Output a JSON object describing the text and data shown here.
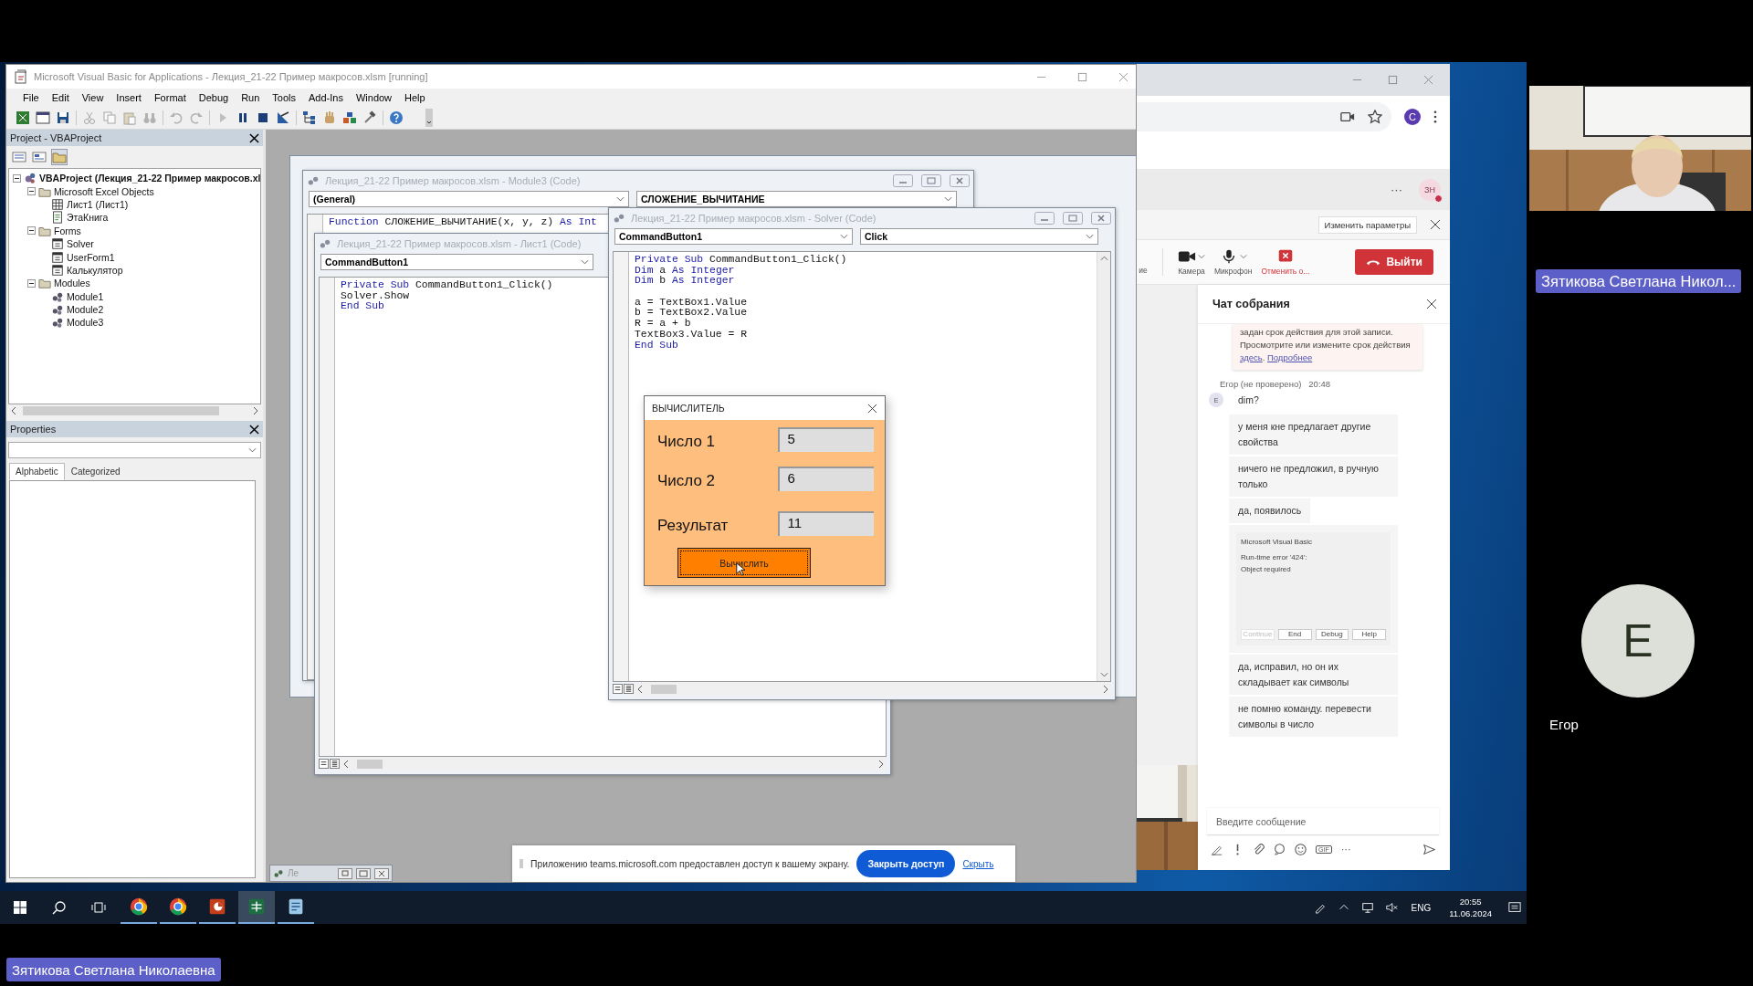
{
  "vba": {
    "title": "Microsoft Visual Basic for Applications - Лекция_21-22 Пример макросов.xlsm [running]",
    "menu": [
      "File",
      "Edit",
      "View",
      "Insert",
      "Format",
      "Debug",
      "Run",
      "Tools",
      "Add-Ins",
      "Window",
      "Help"
    ],
    "project": {
      "title": "Project - VBAProject",
      "tree": [
        {
          "label": "VBAProject (Лекция_21-22 Пример макросов.xl",
          "kind": "project",
          "expanded": true,
          "children": [
            {
              "label": "Microsoft Excel Objects",
              "kind": "folder",
              "expanded": true,
              "children": [
                {
                  "label": "Лист1 (Лист1)",
                  "kind": "sheet"
                },
                {
                  "label": "ЭтаКнига",
                  "kind": "workbook"
                }
              ]
            },
            {
              "label": "Forms",
              "kind": "folder",
              "expanded": true,
              "children": [
                {
                  "label": "Solver",
                  "kind": "form"
                },
                {
                  "label": "UserForm1",
                  "kind": "form"
                },
                {
                  "label": "Калькулятор",
                  "kind": "form"
                }
              ]
            },
            {
              "label": "Modules",
              "kind": "folder",
              "expanded": true,
              "children": [
                {
                  "label": "Module1",
                  "kind": "module"
                },
                {
                  "label": "Module2",
                  "kind": "module"
                },
                {
                  "label": "Module3",
                  "kind": "module"
                }
              ]
            }
          ]
        }
      ]
    },
    "properties": {
      "title": "Properties",
      "tabs": [
        {
          "label": "Alphabetic",
          "selected": true
        },
        {
          "label": "Categorized",
          "selected": false
        }
      ]
    },
    "code_windows": [
      {
        "title": "Лекция_21-22 Пример макросов.xlsm - Module3 (Code)",
        "dropdowns": [
          "(General)",
          "СЛОЖЕНИЕ_ВЫЧИТАНИЕ"
        ],
        "lines": [
          {
            "kind": "code",
            "segments": [
              {
                "kind": "keyword",
                "text": "Function"
              },
              {
                "kind": "plain",
                "text": " СЛОЖЕНИЕ_ВЫЧИТАНИЕ(x, y, z) "
              },
              {
                "kind": "keyword",
                "text": "As Int"
              }
            ]
          }
        ]
      },
      {
        "title": "Лекция_21-22 Пример макросов.xlsm - Лист1 (Code)",
        "dropdowns": [
          "CommandButton1"
        ],
        "lines": [
          {
            "kind": "code",
            "segments": [
              {
                "kind": "keyword",
                "text": "Private Sub"
              },
              {
                "kind": "plain",
                "text": " CommandButton1_Click()"
              }
            ]
          },
          {
            "kind": "code",
            "segments": [
              {
                "kind": "plain",
                "text": "Solver.Show"
              }
            ]
          },
          {
            "kind": "code",
            "segments": [
              {
                "kind": "keyword",
                "text": "End Sub"
              }
            ]
          }
        ]
      },
      {
        "title": "Лекция_21-22 Пример макросов.xlsm - Solver (Code)",
        "dropdowns": [
          "CommandButton1",
          "Click"
        ],
        "lines": [
          {
            "kind": "code",
            "segments": [
              {
                "kind": "keyword",
                "text": "Private Sub"
              },
              {
                "kind": "plain",
                "text": " CommandButton1_Click()"
              }
            ]
          },
          {
            "kind": "code",
            "segments": [
              {
                "kind": "keyword",
                "text": "Dim"
              },
              {
                "kind": "plain",
                "text": " a "
              },
              {
                "kind": "keyword",
                "text": "As Integer"
              }
            ]
          },
          {
            "kind": "code",
            "segments": [
              {
                "kind": "keyword",
                "text": "Dim"
              },
              {
                "kind": "plain",
                "text": " b "
              },
              {
                "kind": "keyword",
                "text": "As Integer"
              }
            ]
          },
          {
            "kind": "blank"
          },
          {
            "kind": "code",
            "segments": [
              {
                "kind": "plain",
                "text": "a = TextBox1.Value"
              }
            ]
          },
          {
            "kind": "code",
            "segments": [
              {
                "kind": "plain",
                "text": "b = TextBox2.Value"
              }
            ]
          },
          {
            "kind": "code",
            "segments": [
              {
                "kind": "plain",
                "text": "R = a + b"
              }
            ]
          },
          {
            "kind": "code",
            "segments": [
              {
                "kind": "plain",
                "text": "TextBox3.Value = R"
              }
            ]
          },
          {
            "kind": "code",
            "segments": [
              {
                "kind": "keyword",
                "text": "End Sub"
              }
            ]
          }
        ]
      }
    ],
    "minimized": {
      "title": "Ле"
    },
    "form": {
      "title": "ВЫЧИСЛИТЕЛЬ",
      "fields": [
        {
          "label": "Число 1",
          "value": "5"
        },
        {
          "label": "Число 2",
          "value": "6"
        },
        {
          "label": "Результат",
          "value": "11"
        }
      ],
      "button": "Вычислить"
    }
  },
  "browser": {
    "avatar": "C"
  },
  "teams": {
    "more": "···",
    "user_initials": "ЗН",
    "notice_button": "Изменить параметры",
    "controls": [
      {
        "label": "ие",
        "kind": "cut"
      },
      {
        "label": "Камера",
        "kind": "camera"
      },
      {
        "label": "Микрофон",
        "kind": "mic"
      },
      {
        "label": "Отменить о...",
        "kind": "stop-share"
      }
    ],
    "leave": "Выйти",
    "chat": {
      "title": "Чат собрания",
      "notice": [
        {
          "kind": "text",
          "text": "задан срок действия для этой записи. Просмотрите или измените срок действия "
        },
        {
          "kind": "link",
          "text": "здесь"
        },
        {
          "kind": "text",
          "text": ". "
        },
        {
          "kind": "link",
          "text": "Подробнее"
        }
      ],
      "sender": "Егор (не проверено)",
      "time": "20:48",
      "sender_initial": "E",
      "messages": [
        {
          "kind": "text",
          "text": "dim?"
        },
        {
          "kind": "text",
          "text": "у меня кне предлагает другие свойства"
        },
        {
          "kind": "text",
          "text": "ничего не предложил, в ручную только"
        },
        {
          "kind": "text",
          "text": "да, появилось"
        },
        {
          "title": "Microsoft Visual Basic",
          "lines": [
            "Run-time error '424':",
            "Object required"
          ],
          "buttons": [
            {
              "label": "Continue",
              "disabled": true
            },
            {
              "label": "End",
              "disabled": false
            },
            {
              "label": "Debug",
              "disabled": false
            },
            {
              "label": "Help",
              "disabled": false
            }
          ]
        },
        {
          "kind": "text",
          "text": "да, исправил, но он их складывает как символы"
        },
        {
          "kind": "text",
          "text": "не помню команду. перевести символы в число"
        }
      ],
      "placeholder": "Введите сообщение",
      "gif": "GIF",
      "more": "···"
    }
  },
  "share_bar": {
    "message": "Приложению teams.microsoft.com предоставлен доступ к вашему экрану.",
    "stop": "Закрыть доступ",
    "hide": "Скрыть"
  },
  "taskbar": {
    "apps": [
      {
        "kind": "chrome",
        "selected": false
      },
      {
        "kind": "chrome",
        "selected": false
      },
      {
        "kind": "powerpoint",
        "selected": false
      },
      {
        "kind": "excel",
        "selected": true
      },
      {
        "kind": "editor",
        "selected": false
      }
    ],
    "lang": "ENG",
    "time": "20:55",
    "date": "11.06.2024"
  },
  "tiles": {
    "presenter_name": "Зятикова Светлана Никол...",
    "participant_initial": "E",
    "participant_name": "Егор",
    "self_name": "Зятикова Светлана Николаевна"
  }
}
